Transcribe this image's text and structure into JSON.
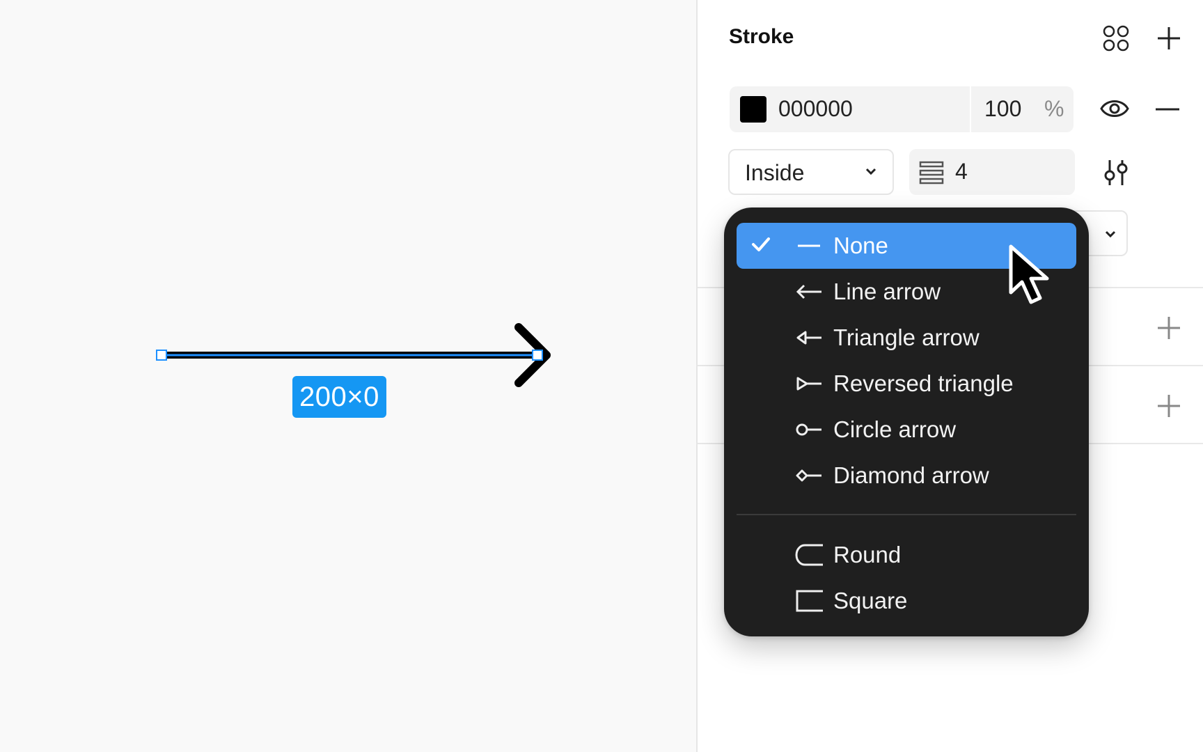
{
  "canvas": {
    "selection_size": "200×0"
  },
  "stroke": {
    "title": "Stroke",
    "color_hex": "000000",
    "swatch_color": "#000000",
    "opacity": "100",
    "opacity_unit": "%",
    "position": "Inside",
    "weight": "4"
  },
  "endpoint_menu": {
    "selected": "None",
    "items": [
      {
        "label": "None",
        "icon": "line-icon",
        "checked": true
      },
      {
        "label": "Line arrow",
        "icon": "line-arrow-icon"
      },
      {
        "label": "Triangle arrow",
        "icon": "triangle-arrow-icon"
      },
      {
        "label": "Reversed triangle",
        "icon": "reversed-triangle-icon"
      },
      {
        "label": "Circle arrow",
        "icon": "circle-arrow-icon"
      },
      {
        "label": "Diamond arrow",
        "icon": "diamond-arrow-icon"
      }
    ],
    "caps": [
      {
        "label": "Round",
        "icon": "round-cap-icon"
      },
      {
        "label": "Square",
        "icon": "square-cap-icon"
      }
    ]
  },
  "colors": {
    "accent": "#1597f3",
    "menu_bg": "#1f1f1f",
    "menu_highlight": "#4596f0"
  }
}
